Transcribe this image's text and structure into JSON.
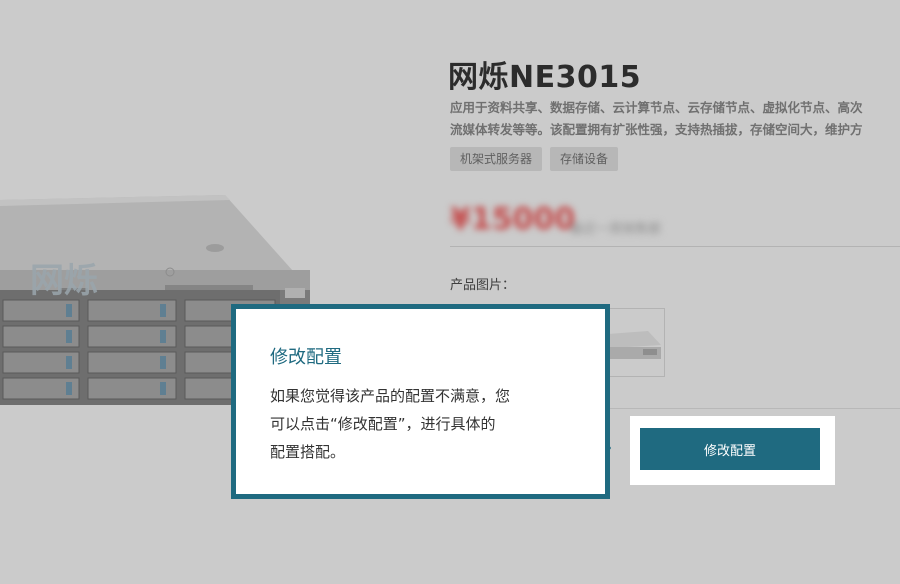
{
  "product": {
    "title": "网烁NE3015",
    "description_lines": [
      "应用于资料共享、数据存储、云计算节点、云存储节点、虚拟化节点、高次",
      "流媒体转发等等。该配置拥有扩张性强，支持热插拔，存储空间大，维护方"
    ],
    "tags": [
      "机架式服务器",
      "存储设备"
    ],
    "price_main": "¥15000",
    "price_note": "最近一周销售额",
    "images_label": "产品图片："
  },
  "action": {
    "modify_label": "修改配置"
  },
  "tooltip": {
    "title": "修改配置",
    "body_lines": [
      "如果您觉得该产品的配置不满意，您",
      "可以点击“修改配置”，进行具体的",
      "配置搭配。"
    ]
  },
  "colors": {
    "accent": "#1f6a80",
    "overlay_background": "#cbcbcb",
    "price": "#c44b4b"
  },
  "icons": {
    "server_illustration": "rack-server-image",
    "thumbnail": "rack-server-thumbnail"
  }
}
